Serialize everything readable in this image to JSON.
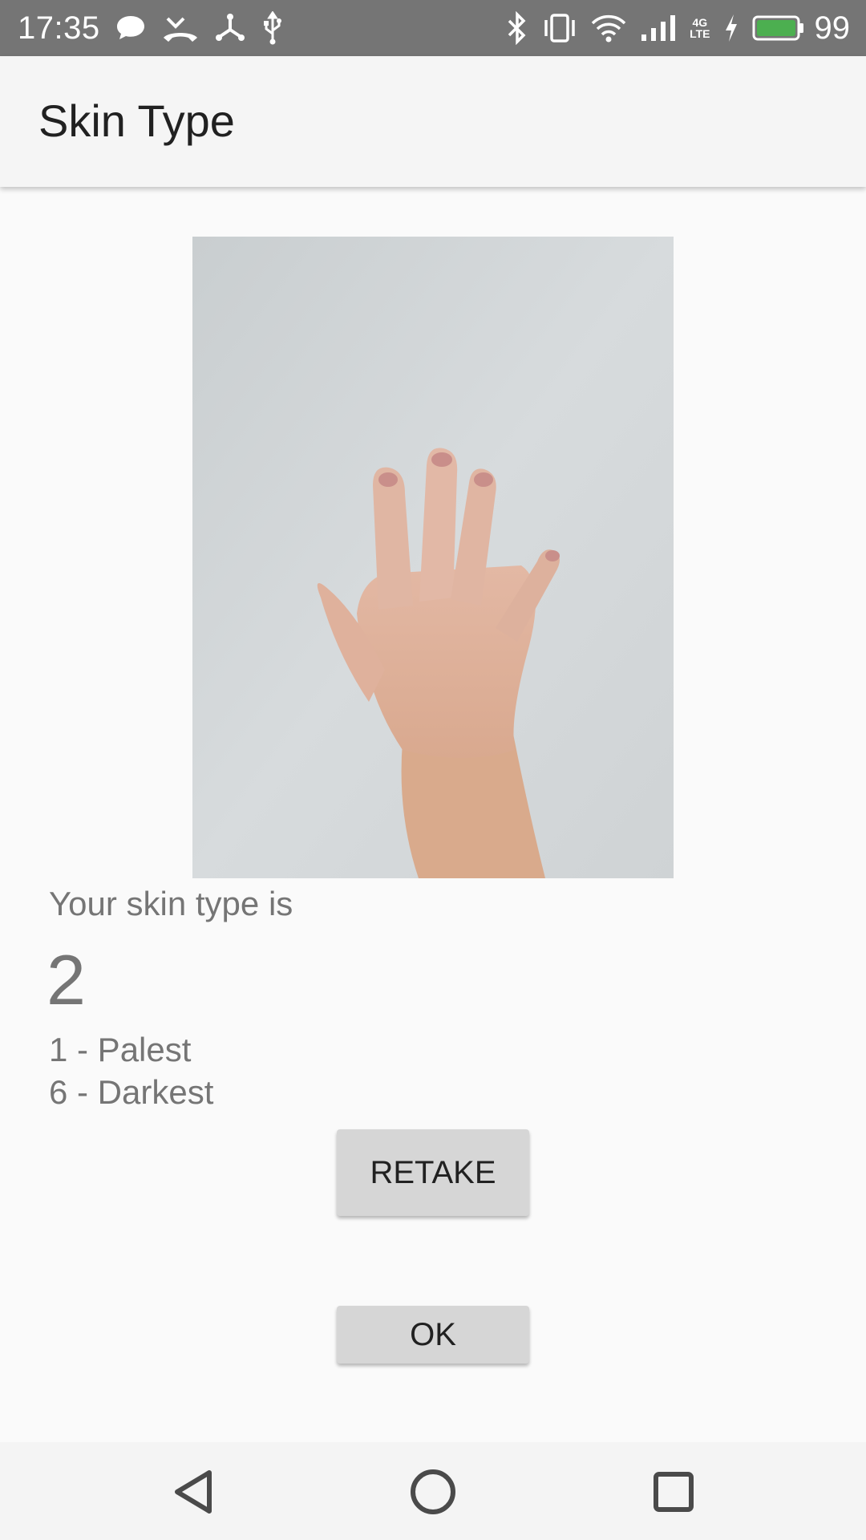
{
  "status_bar": {
    "time": "17:35",
    "battery_level": "99",
    "network_type": "4G",
    "network_sub": "LTE",
    "left_icons": [
      "chat-bubble-icon",
      "missed-call-icon",
      "usb-tether-icon",
      "usb-icon"
    ],
    "right_icons": [
      "bluetooth-icon",
      "vibrate-icon",
      "wifi-icon",
      "signal-icon",
      "charging-icon",
      "battery-icon"
    ],
    "battery_color": "#4caf50"
  },
  "app_bar": {
    "title": "Skin Type"
  },
  "result": {
    "label": "Your skin type is",
    "value": "2",
    "scale_low": "1 - Palest",
    "scale_high": "6 - Darkest"
  },
  "buttons": {
    "retake": "RETAKE",
    "ok": "OK"
  },
  "nav_bar": {
    "icons": [
      "back-icon",
      "home-icon",
      "recents-icon"
    ]
  }
}
